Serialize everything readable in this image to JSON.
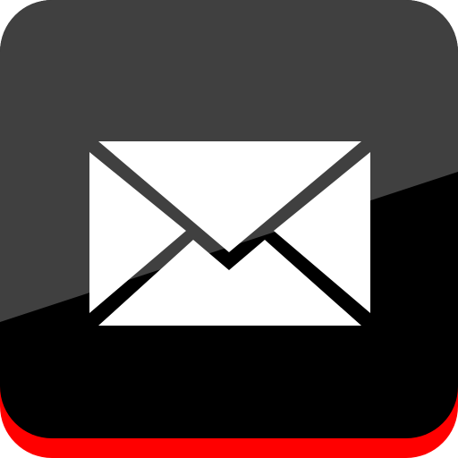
{
  "icon": {
    "name": "mail-icon",
    "glyph": "envelope",
    "colors": {
      "base": "#ff0000",
      "body_dark": "#000000",
      "body_highlight": "#404040",
      "glyph": "#ffffff"
    }
  }
}
